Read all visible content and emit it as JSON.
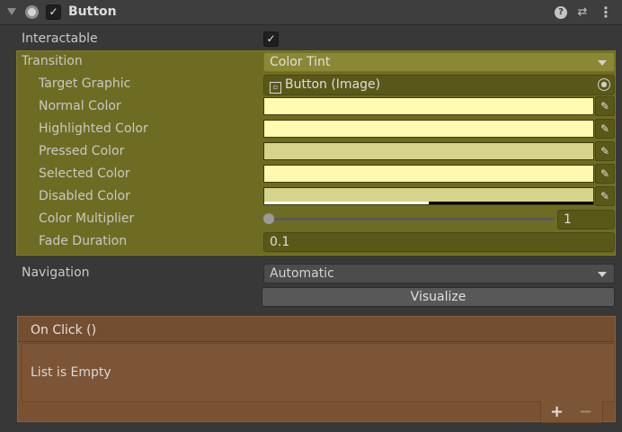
{
  "header": {
    "title": "Button",
    "enabled_check": "✓",
    "help_glyph": "?",
    "presets_glyph": "⇄",
    "more_glyph": "⋮"
  },
  "interactable": {
    "label": "Interactable",
    "check": "✓"
  },
  "transition": {
    "label": "Transition",
    "value": "Color Tint",
    "target_graphic": {
      "label": "Target Graphic",
      "value": "Button (Image)"
    },
    "normal_color": {
      "label": "Normal Color",
      "color": "#fffbb0"
    },
    "highlighted_color": {
      "label": "Highlighted Color",
      "color": "#fffbb0"
    },
    "pressed_color": {
      "label": "Pressed Color",
      "color": "#d6d38c"
    },
    "selected_color": {
      "label": "Selected Color",
      "color": "#fdf9ae"
    },
    "disabled_color": {
      "label": "Disabled Color",
      "color": "#d6d38c",
      "alpha": 0.5
    },
    "color_multiplier": {
      "label": "Color Multiplier",
      "value": "1",
      "slider_fraction": 0
    },
    "fade_duration": {
      "label": "Fade Duration",
      "value": "0.1"
    }
  },
  "navigation": {
    "label": "Navigation",
    "value": "Automatic"
  },
  "visualize_label": "Visualize",
  "on_click": {
    "title": "On Click ()",
    "empty_text": "List is Empty",
    "add_glyph": "+",
    "remove_glyph": "−"
  },
  "colors": {
    "panel_bg": "#383838",
    "transition_highlight": "#6e6c22",
    "event_highlight": "#7a5232"
  }
}
